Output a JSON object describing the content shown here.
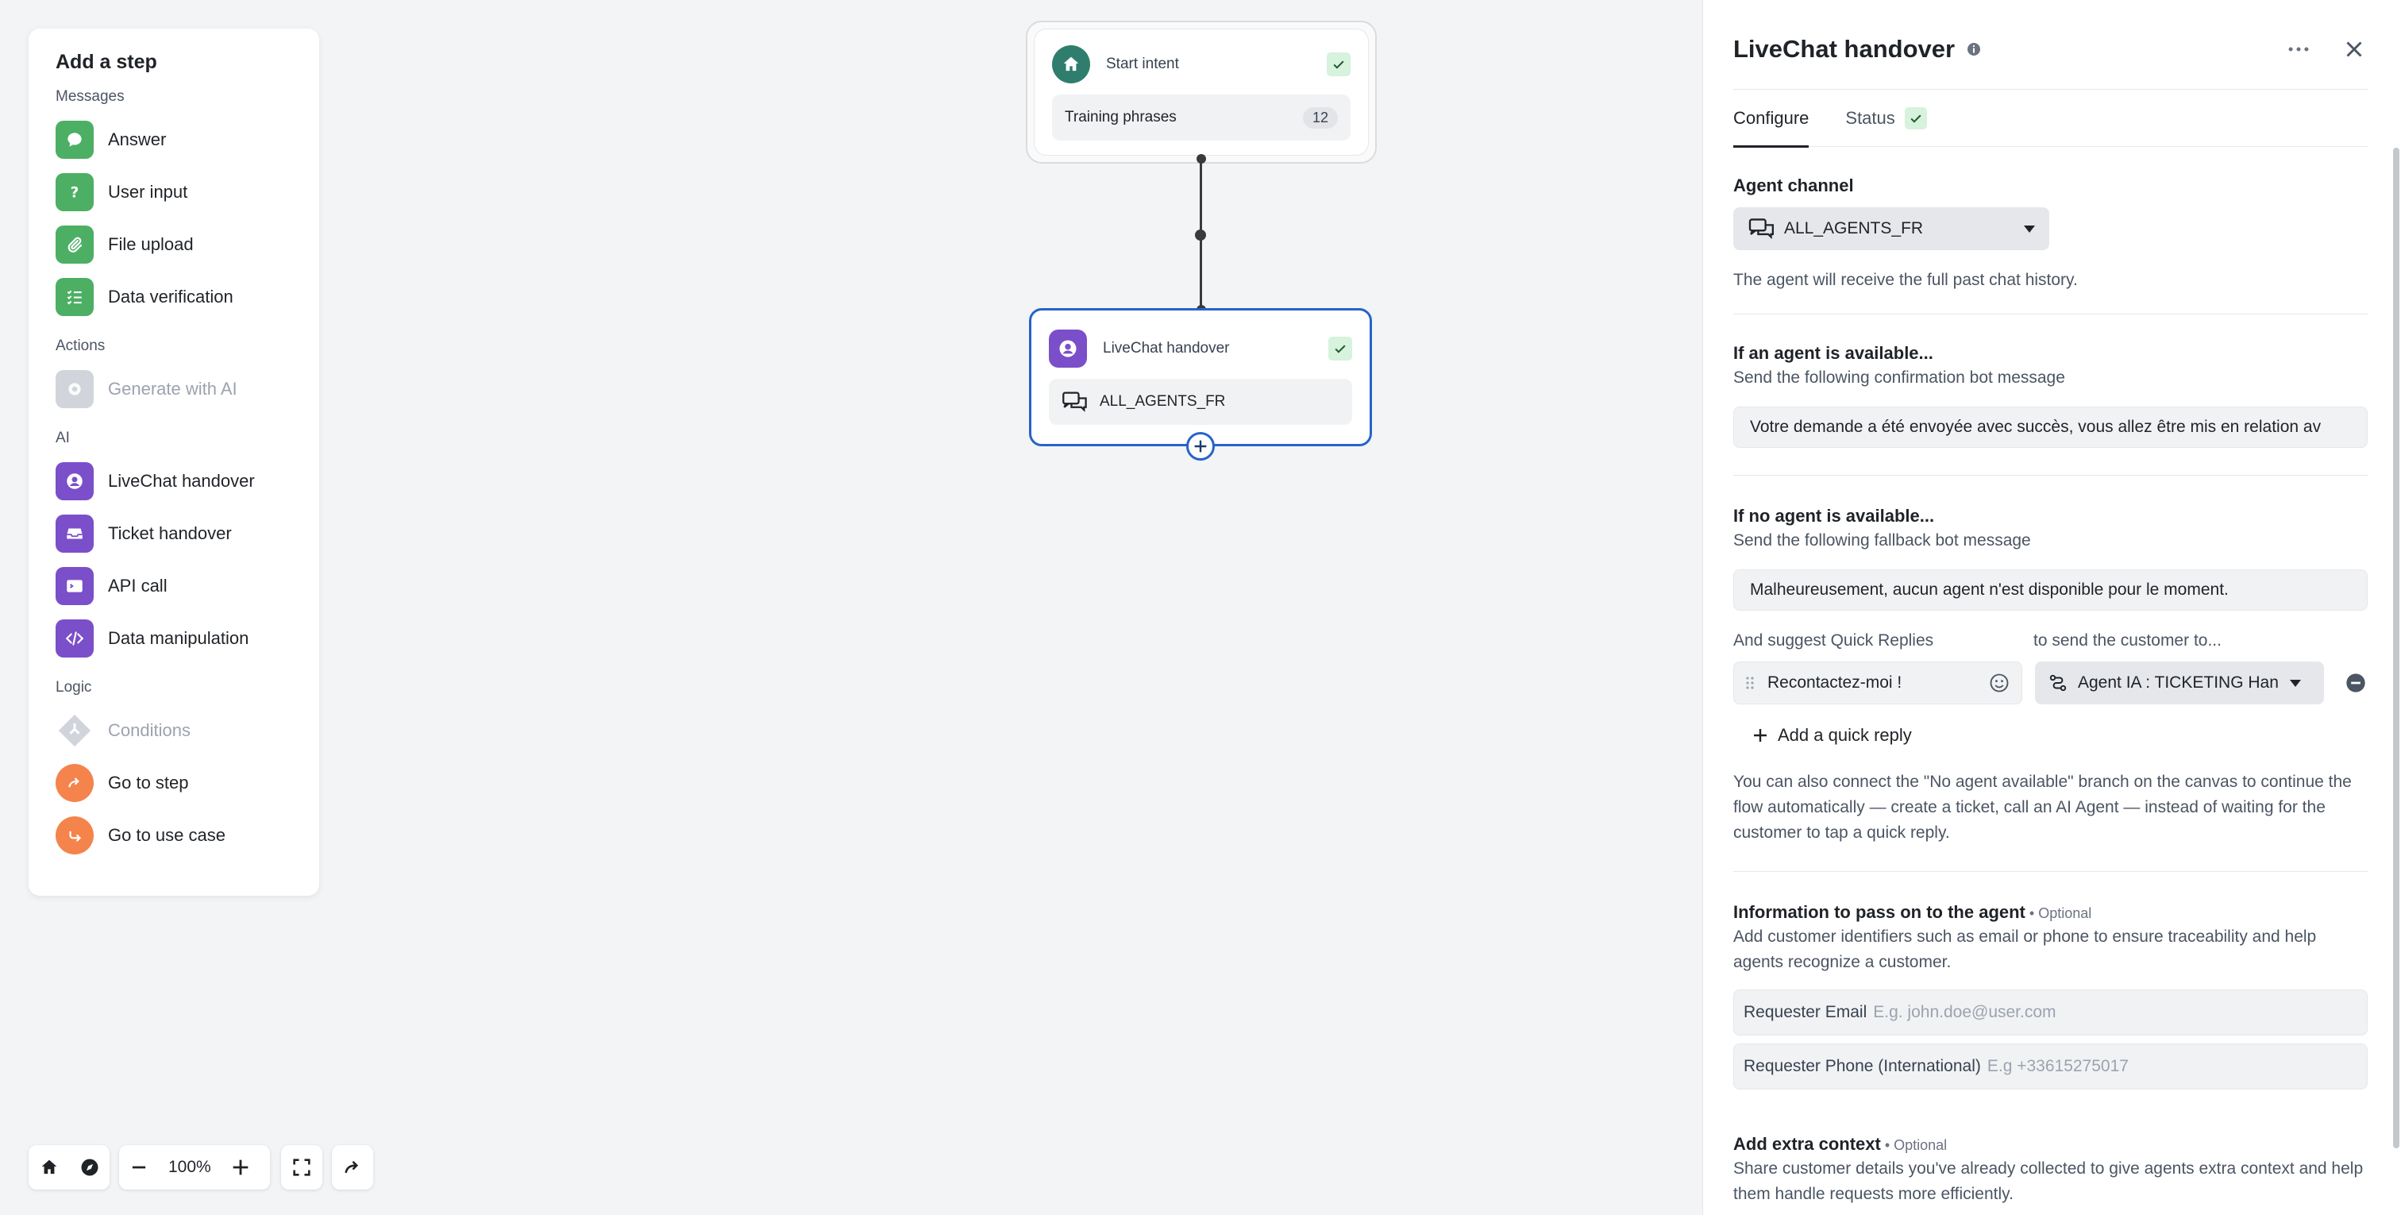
{
  "palette": {
    "title": "Add a step",
    "sections": {
      "messages": "Messages",
      "actions": "Actions",
      "ai": "AI",
      "logic": "Logic"
    },
    "items": {
      "answer": "Answer",
      "user_input": "User input",
      "file_upload": "File upload",
      "data_verification": "Data verification",
      "generate_ai": "Generate with AI",
      "livechat": "LiveChat handover",
      "ticket": "Ticket handover",
      "api_call": "API call",
      "data_manipulation": "Data manipulation",
      "conditions": "Conditions",
      "go_to_step": "Go to step",
      "go_to_use_case": "Go to use case"
    }
  },
  "flow": {
    "start_node": {
      "title": "Start intent",
      "body_label": "Training phrases",
      "count": "12"
    },
    "livechat_node": {
      "title": "LiveChat handover",
      "body_label": "ALL_AGENTS_FR"
    }
  },
  "toolbar": {
    "zoom": "100%"
  },
  "panel": {
    "title": "LiveChat handover",
    "tabs": {
      "configure": "Configure",
      "status": "Status"
    },
    "agent_channel": {
      "label": "Agent channel",
      "value": "ALL_AGENTS_FR",
      "help": "The agent will receive the full past chat history."
    },
    "available": {
      "label": "If an agent is available...",
      "sub": "Send the following confirmation bot message",
      "message": "Votre demande a été envoyée avec succès, vous allez être mis en relation av"
    },
    "not_available": {
      "label": "If no agent is available...",
      "sub": "Send the following fallback bot message",
      "message": "Malheureusement, aucun agent n'est disponible pour le moment."
    },
    "quick_replies": {
      "suggest_label": "And suggest Quick Replies",
      "send_to_label": "to send the customer to...",
      "reply_value": "Recontactez-moi !",
      "target_value": "Agent IA : TICKETING Han",
      "add_label": "Add a quick reply",
      "help": "You can also connect the \"No agent available\" branch on the canvas to continue the flow automatically — create a ticket, call an AI Agent — instead of waiting for the customer to tap a quick reply."
    },
    "info_pass": {
      "label": "Information to pass on to the agent",
      "optional": " • Optional",
      "help": "Add customer identifiers such as email or phone to ensure traceability and help agents recognize a customer.",
      "email_key": "Requester Email",
      "email_placeholder": "E.g. john.doe@user.com",
      "phone_key": "Requester Phone (International)",
      "phone_placeholder": "E.g +33615275017"
    },
    "extra_context": {
      "label": "Add extra context",
      "optional": " • Optional",
      "help": "Share customer details you've already collected to give agents extra context and help them handle requests more efficiently."
    }
  },
  "colors": {
    "green": "#4caf64",
    "purple": "#7b4fc9",
    "orange": "#f4844c",
    "teal": "#2f7d6d",
    "blue_selection": "#2563c9"
  }
}
